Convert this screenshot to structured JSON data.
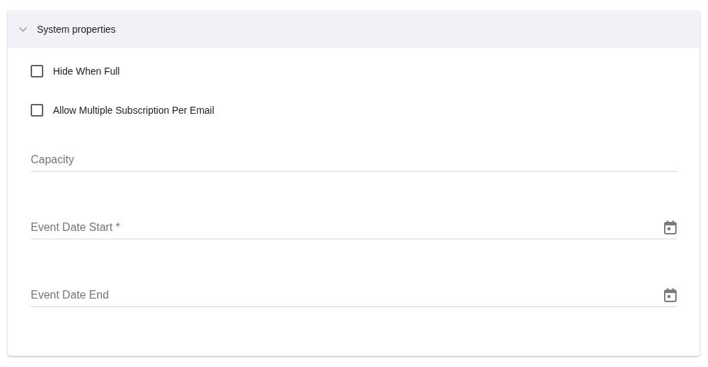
{
  "panel": {
    "title": "System properties",
    "expanded": true
  },
  "checkboxes": [
    {
      "label": "Hide When Full",
      "checked": false
    },
    {
      "label": "Allow Multiple Subscription Per Email",
      "checked": false
    }
  ],
  "fields": [
    {
      "kind": "text",
      "placeholder": "Capacity"
    },
    {
      "kind": "date",
      "placeholder": "Event Date Start *"
    },
    {
      "kind": "date",
      "placeholder": "Event Date End"
    }
  ]
}
